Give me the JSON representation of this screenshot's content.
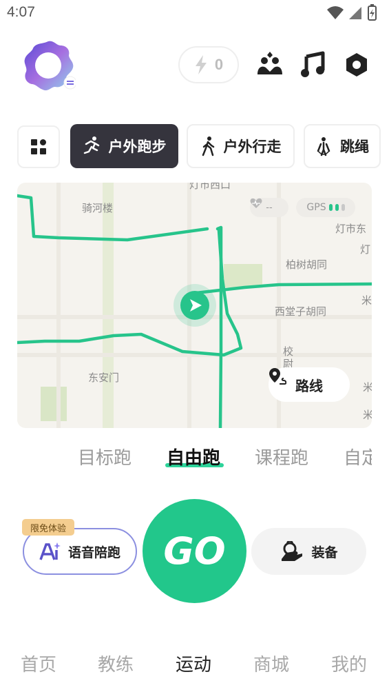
{
  "status_bar": {
    "time": "4:07"
  },
  "header": {
    "energy_count": "0"
  },
  "modes": {
    "items": [
      {
        "label": "户外跑步",
        "active": true
      },
      {
        "label": "户外行走",
        "active": false
      },
      {
        "label": "跳绳",
        "active": false
      }
    ]
  },
  "map": {
    "labels": [
      "灯市西口",
      "骑河楼",
      "灯市东",
      "灯",
      "柏树胡同",
      "米",
      "西堂子胡同",
      "校",
      "尉",
      "东安门",
      "米",
      "米"
    ],
    "heart_rate": "--",
    "gps_label": "GPS",
    "route_button": "路线"
  },
  "run_types": {
    "items": [
      "目标跑",
      "自由跑",
      "课程跑",
      "自定"
    ],
    "active_index": 1
  },
  "actions": {
    "voice_badge": "限免体验",
    "voice_label": "语音陪跑",
    "go_label": "GO",
    "gear_label": "装备"
  },
  "bottom_nav": {
    "items": [
      "首页",
      "教练",
      "运动",
      "商城",
      "我的"
    ],
    "active_index": 2
  },
  "colors": {
    "accent": "#22c78b",
    "route": "#27c48b",
    "dark_tab": "#35343d",
    "voice_border": "#8b8fe0",
    "badge": "#f4cd8f"
  }
}
